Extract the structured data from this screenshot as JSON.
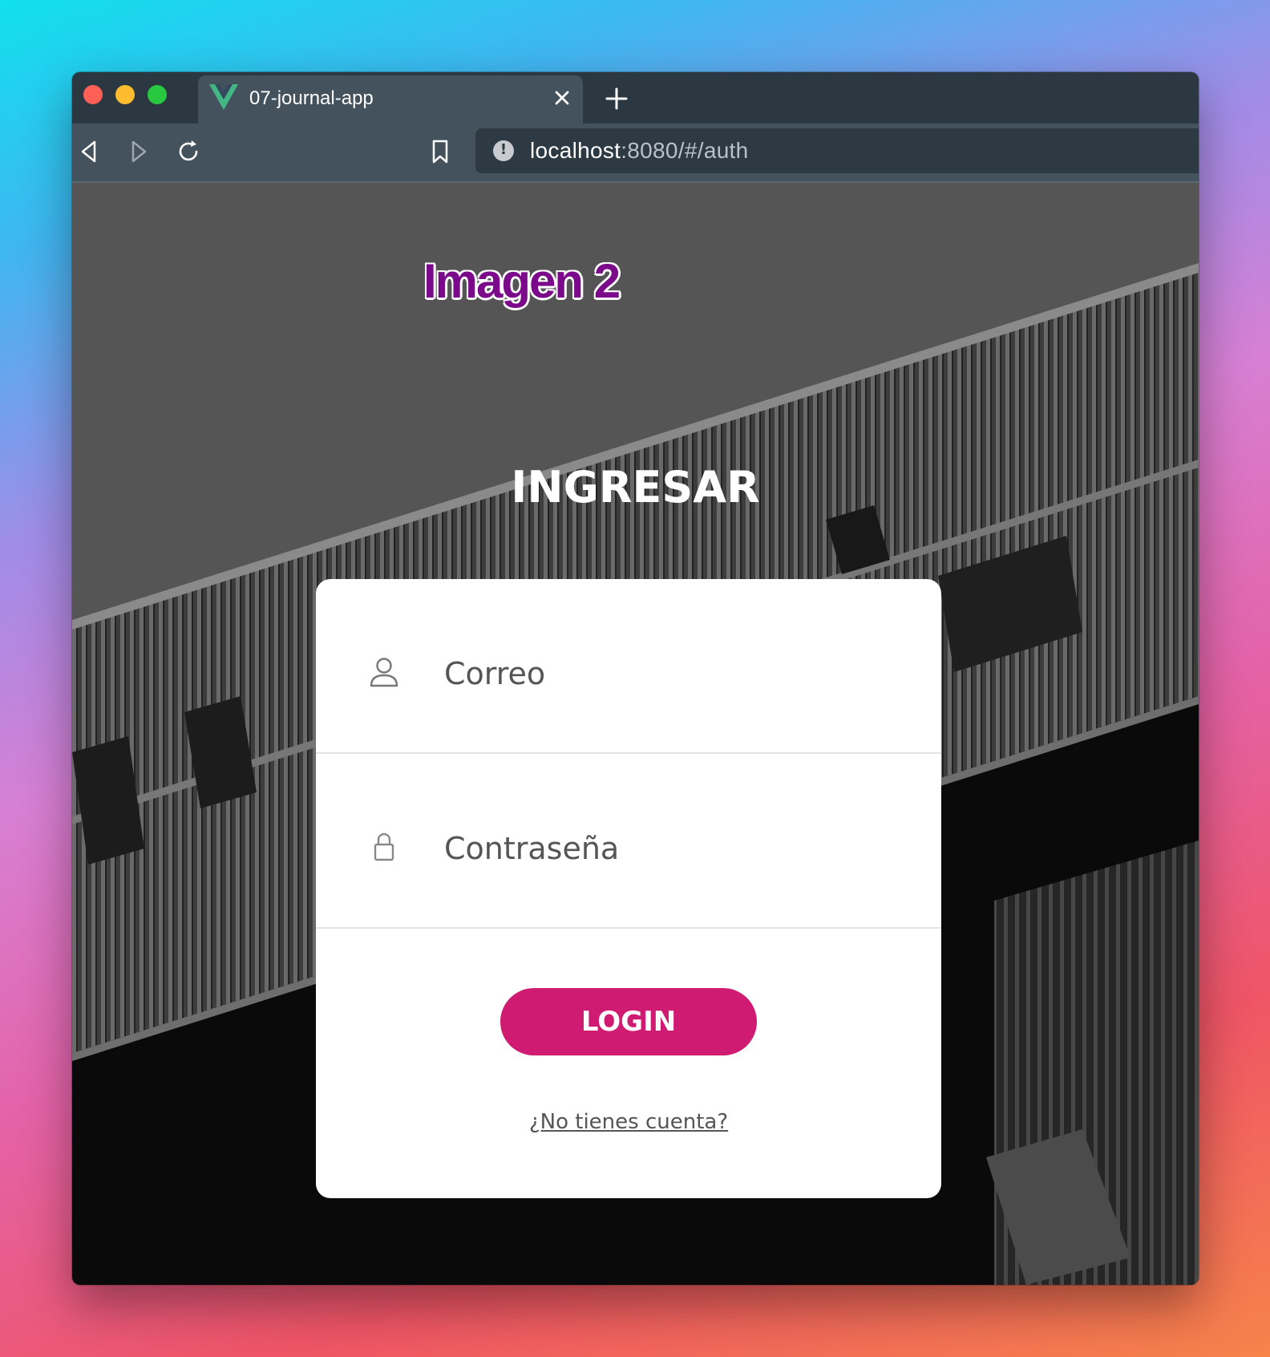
{
  "browser": {
    "tab_title": "07-journal-app",
    "url_host": "localhost",
    "url_path": ":8080/#/auth"
  },
  "overlay": {
    "label": "Imagen 2"
  },
  "auth": {
    "title": "INGRESAR",
    "email_placeholder": "Correo",
    "password_placeholder": "Contraseña",
    "login_label": "LOGIN",
    "signup_link": "¿No tienes cuenta?"
  },
  "icons": {
    "favicon": "vue-logo-icon",
    "tab_close": "close-icon",
    "new_tab": "plus-icon",
    "back": "back-arrow-icon",
    "forward": "forward-arrow-icon",
    "reload": "reload-icon",
    "bookmark": "bookmark-icon",
    "site_info": "info-icon",
    "email_field": "user-icon",
    "password_field": "lock-icon"
  },
  "colors": {
    "accent": "#d01b72",
    "browser_chrome": "#2b3842",
    "tab_active": "#43525d",
    "overlay_label": "#7b0a8a"
  }
}
